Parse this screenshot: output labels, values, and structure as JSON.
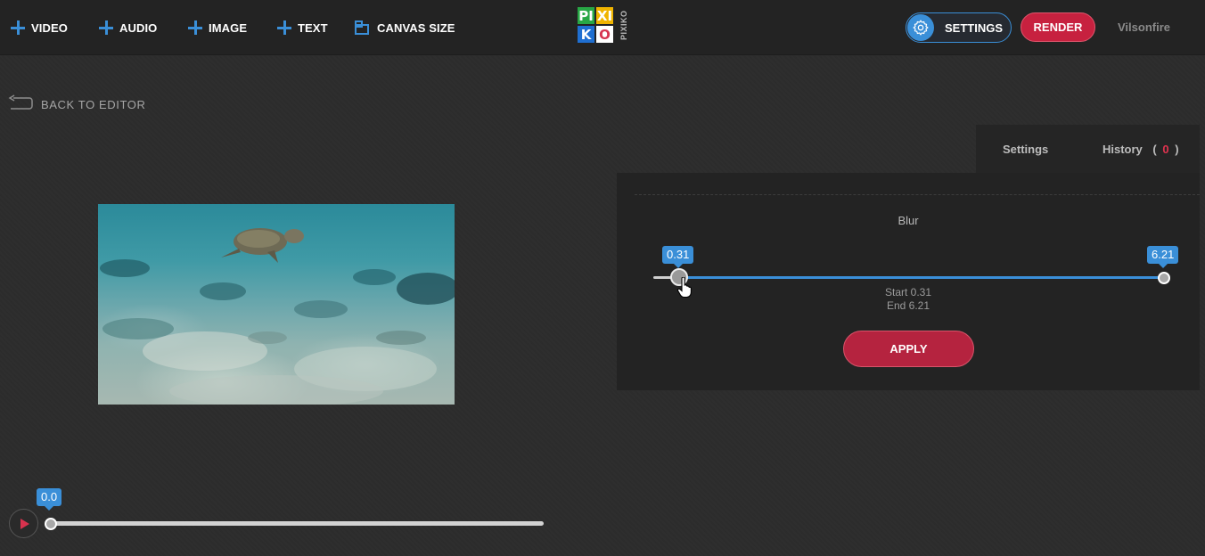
{
  "toolbar": {
    "video_label": "VIDEO",
    "audio_label": "AUDIO",
    "image_label": "IMAGE",
    "text_label": "TEXT",
    "canvas_size_label": "CANVAS SIZE",
    "settings_label": "SETTINGS",
    "render_label": "RENDER",
    "username": "Vilsonfire"
  },
  "logo": {
    "letters": [
      "PI",
      "XI",
      "K",
      "O"
    ],
    "vertical_text": "PIXIKO",
    "colors": [
      "#28a745",
      "#f0b400",
      "#1f6fd1",
      "#ffffff"
    ]
  },
  "nav": {
    "back_label": "BACK TO EDITOR"
  },
  "panel": {
    "tabs": {
      "settings_label": "Settings",
      "history_label": "History",
      "history_count_open": "(",
      "history_count": "0",
      "history_count_close": ")"
    },
    "effect_title": "Blur",
    "range": {
      "min_label": "0.31",
      "max_label": "6.21",
      "start_text": "Start 0.31",
      "end_text": "End 6.21"
    },
    "apply_label": "APPLY"
  },
  "player": {
    "time_label": "0.0"
  },
  "colors": {
    "accent": "#3a8fd8",
    "danger": "#c7213f"
  }
}
